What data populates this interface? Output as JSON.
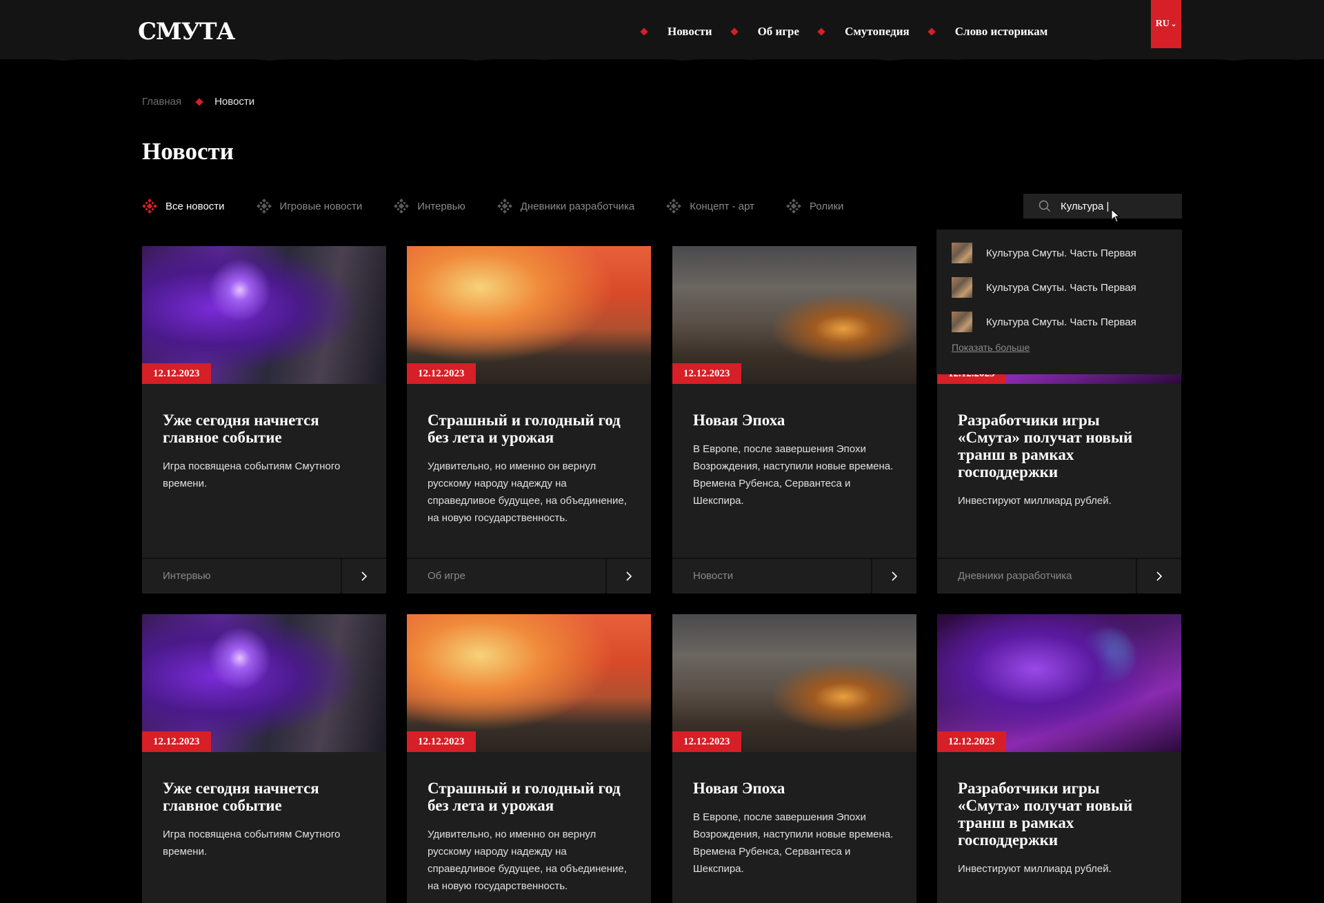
{
  "header": {
    "logo": "СМУТА",
    "nav": [
      "Новости",
      "Об игре",
      "Смутопедия",
      "Слово историкам"
    ],
    "lang": "RU"
  },
  "breadcrumb": {
    "home": "Главная",
    "current": "Новости"
  },
  "page_title": "Новости",
  "filters": [
    "Все новости",
    "Игровые новости",
    "Интервью",
    "Дневники разработчика",
    "Концепт - арт",
    "Ролики"
  ],
  "search": {
    "value": "Культура |"
  },
  "dropdown": {
    "items": [
      "Культура Смуты. Часть Первая",
      "Культура Смуты. Часть Первая",
      "Культура Смуты. Часть Первая"
    ],
    "more": "Показать больше"
  },
  "cards": [
    {
      "date": "12.12.2023",
      "title": "Уже сегодня начнется главное событие",
      "text": "Игра посвящена событиям Смутного времени.",
      "tag": "Интервью",
      "art": "gamer"
    },
    {
      "date": "12.12.2023",
      "title": "Страшный и голодный год без лета и урожая",
      "text": "Удивительно, но именно он вернул русскому народу надежду на справедливое будущее, на объединение, на новую государственность.",
      "tag": "Об игре",
      "art": "fire"
    },
    {
      "date": "12.12.2023",
      "title": "Новая Эпоха",
      "text": "В Европе, после завершения Эпохи Возрождения, наступили новые времена. Времена Рубенса, Сервантеса и Шекспира.",
      "tag": "Новости",
      "art": "battle"
    },
    {
      "date": "12.12.2023",
      "title": "Разработчики игры «Смута» получат новый транш в рамках господдержки",
      "text": "Инвестируют миллиард рублей.",
      "tag": "Дневники разработчика",
      "art": "keyboard"
    },
    {
      "date": "12.12.2023",
      "title": "Уже сегодня начнется главное событие",
      "text": "Игра посвящена событиям Смутного времени.",
      "tag": "",
      "art": "gamer"
    },
    {
      "date": "12.12.2023",
      "title": "Страшный и голодный год без лета и урожая",
      "text": "Удивительно, но именно он вернул русскому народу надежду на справедливое будущее, на объединение, на новую государственность.",
      "tag": "",
      "art": "fire"
    },
    {
      "date": "12.12.2023",
      "title": "Новая Эпоха",
      "text": "В Европе, после завершения Эпохи Возрождения, наступили новые времена. Времена Рубенса, Сервантеса и Шекспира.",
      "tag": "",
      "art": "battle"
    },
    {
      "date": "12.12.2023",
      "title": "Разработчики игры «Смута» получат новый транш в рамках господдержки",
      "text": "Инвестируют миллиард рублей.",
      "tag": "",
      "art": "keyboard"
    }
  ],
  "colors": {
    "accent": "#d61f26",
    "card_bg": "#1e1e1e",
    "header_bg": "#141414"
  }
}
